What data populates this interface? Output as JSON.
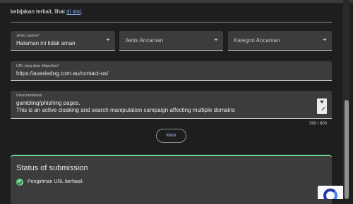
{
  "intro": {
    "text_before": "kebijakan terkait, lihat ",
    "link": "di sini",
    "text_after": "."
  },
  "form": {
    "report_type": {
      "label": "Jenis Laporan*",
      "value": "Halaman ini tidak aman"
    },
    "threat_type": {
      "placeholder": "Jenis Ancaman"
    },
    "threat_category": {
      "placeholder": "Kategori Ancaman"
    },
    "url_field": {
      "label": "URL yang akan dilaporkan*",
      "value": "https://aussiedog.com.au/contact-us/"
    },
    "details": {
      "label": "Detail tambahan",
      "line1": "gambling/phishing pages.",
      "line2": "This is an active cloaking and search manipulation campaign affecting multiple domains",
      "counter": "390 / 800"
    },
    "send_label": "Kirim"
  },
  "status": {
    "title": "Status of submission",
    "message": "Pengiriman URL berhasil.",
    "accent_color": "#6dd58c"
  },
  "icons": {
    "dropdown": "chevron-down-icon",
    "resize": "textarea-resize-icon",
    "success": "check-circle-icon",
    "recaptcha": "recaptcha-icon"
  }
}
